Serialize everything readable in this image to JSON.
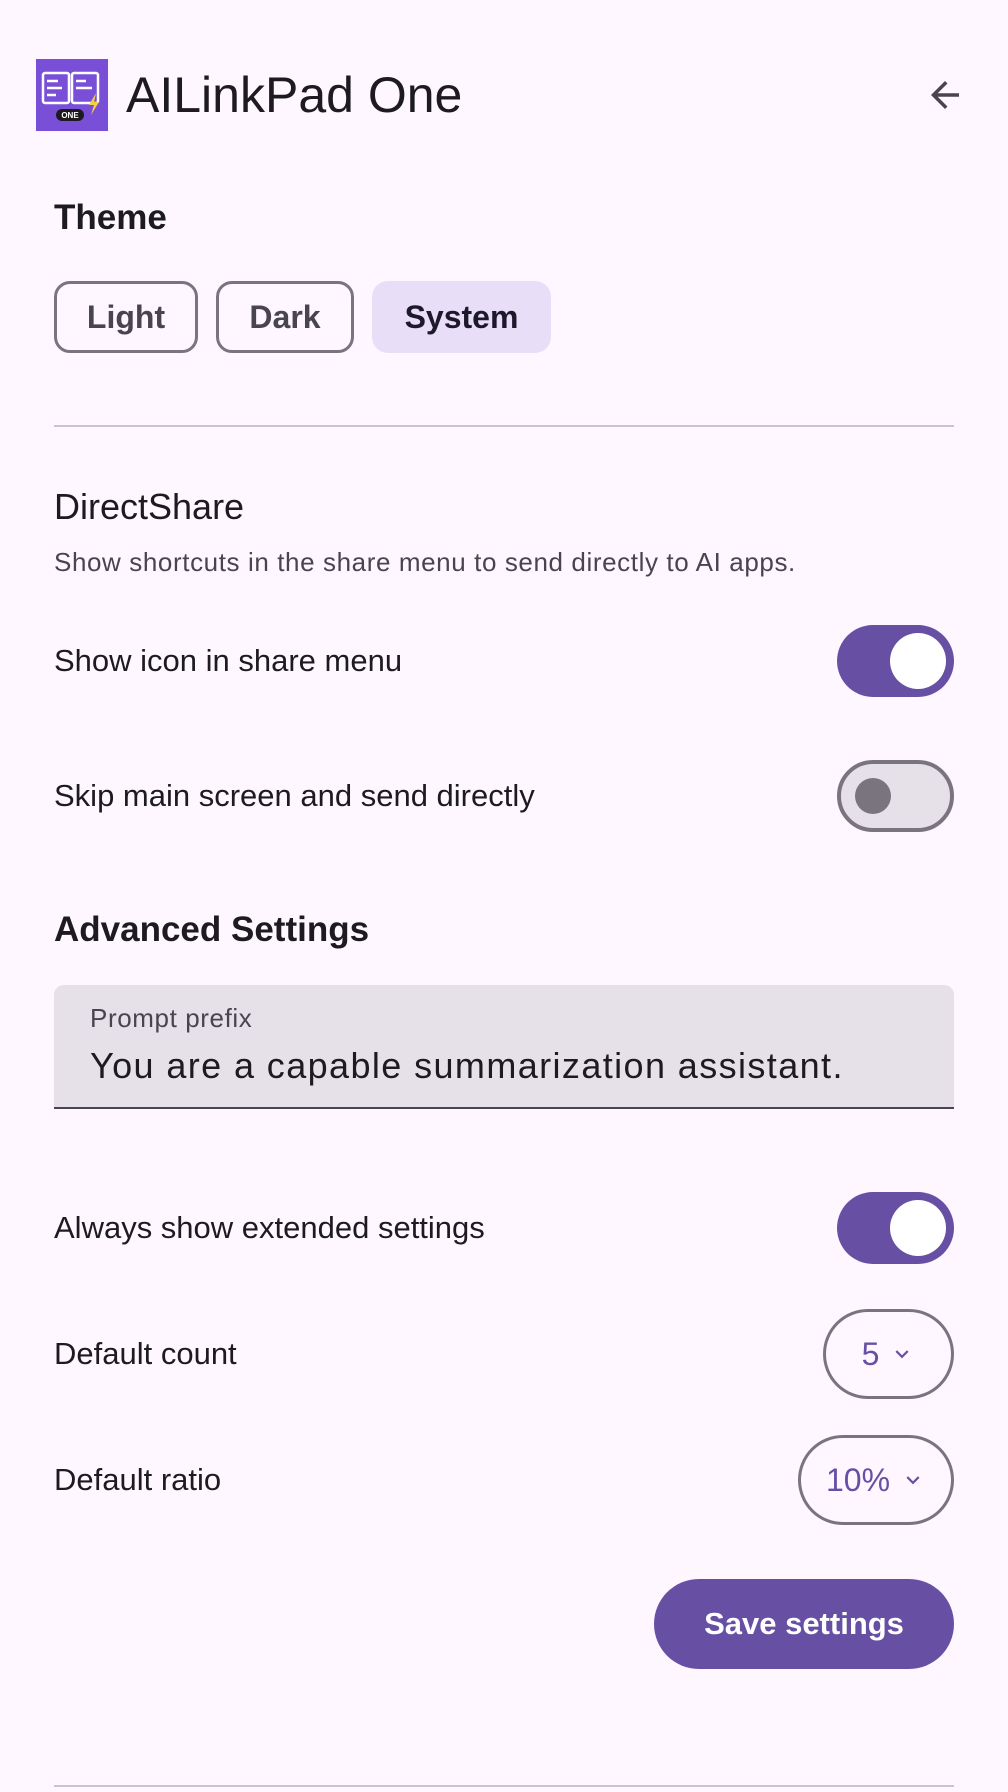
{
  "header": {
    "app_title": "AILinkPad One",
    "icon_badge": "ONE",
    "back_icon": "arrow-back-icon"
  },
  "theme": {
    "title": "Theme",
    "options": [
      "Light",
      "Dark",
      "System"
    ],
    "selected": "System"
  },
  "directshare": {
    "title": "DirectShare",
    "description": "Show shortcuts in the share menu to send directly to AI apps.",
    "show_icon_label": "Show icon in share menu",
    "show_icon_on": true,
    "skip_main_label": "Skip main screen and send directly",
    "skip_main_on": false
  },
  "advanced": {
    "title": "Advanced Settings",
    "prompt_prefix_label": "Prompt prefix",
    "prompt_prefix_value": "You are a capable summarization assistant.",
    "extended_label": "Always show extended settings",
    "extended_on": true,
    "default_count_label": "Default count",
    "default_count_value": "5",
    "default_ratio_label": "Default ratio",
    "default_ratio_value": "10%"
  },
  "actions": {
    "save_label": "Save settings"
  },
  "colors": {
    "primary": "#6750a4",
    "background": "#fef7ff",
    "selected_tonal": "#e8def8",
    "app_icon": "#7a4fd8"
  }
}
